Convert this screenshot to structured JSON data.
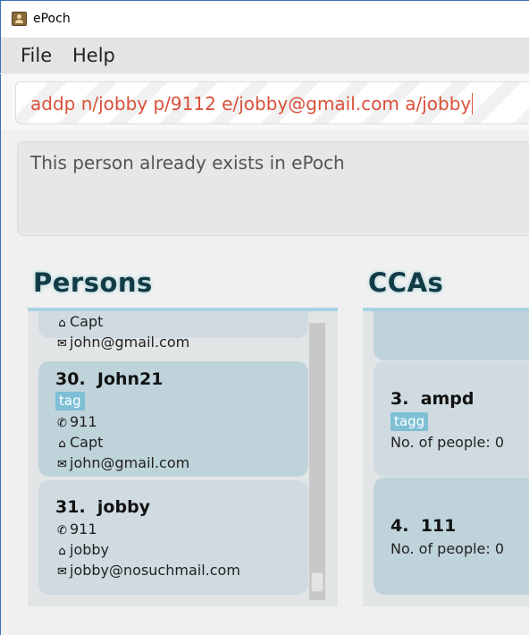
{
  "window": {
    "title": "ePoch",
    "icon": "user-card-icon"
  },
  "menu": {
    "file": "File",
    "help": "Help"
  },
  "command": {
    "value": "addp n/jobby p/9112 e/jobby@gmail.com a/jobby"
  },
  "result": {
    "message": "This person already exists in ePoch"
  },
  "persons": {
    "title": "Persons",
    "partial_card": {
      "address": "Capt",
      "email": "john@gmail.com"
    },
    "cards": [
      {
        "index": "30.",
        "name": "John21",
        "tag": "tag",
        "phone": "911",
        "address": "Capt",
        "email": "john@gmail.com"
      },
      {
        "index": "31.",
        "name": "jobby",
        "phone": "911",
        "address": "jobby",
        "email": "jobby@nosuchmail.com"
      }
    ]
  },
  "ccas": {
    "title": "CCAs",
    "cards": [
      {
        "index": "3.",
        "name": "ampd",
        "tag": "tagg",
        "people": "No. of people: 0"
      },
      {
        "index": "4.",
        "name": "111",
        "people": "No. of people: 0"
      }
    ]
  },
  "colors": {
    "command_text": "#d9503a",
    "accent_rule": "#a9d2e0",
    "tag_bg": "#7fbfd5",
    "card_bg": "#cfdbe0",
    "card_selected_bg": "#bfd3da",
    "panel_title": "#123b45"
  }
}
